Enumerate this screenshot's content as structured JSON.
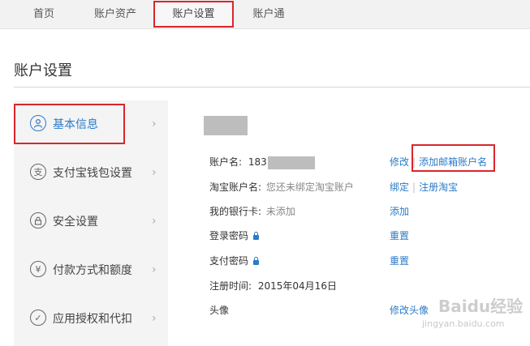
{
  "nav": {
    "tabs": [
      {
        "label": "首页"
      },
      {
        "label": "账户资产"
      },
      {
        "label": "账户设置"
      },
      {
        "label": "账户通"
      }
    ]
  },
  "page": {
    "title": "账户设置"
  },
  "sidebar": {
    "items": [
      {
        "label": "基本信息",
        "icon": "user-icon"
      },
      {
        "label": "支付宝钱包设置",
        "icon": "wallet-icon"
      },
      {
        "label": "安全设置",
        "icon": "lock-icon"
      },
      {
        "label": "付款方式和额度",
        "icon": "yen-icon"
      },
      {
        "label": "应用授权和代扣",
        "icon": "check-icon"
      }
    ]
  },
  "info": {
    "account_label": "账户名:",
    "account_value": "183",
    "taobao_label": "淘宝账户名:",
    "taobao_value": "您还未绑定淘宝账户",
    "bank_label": "我的银行卡:",
    "bank_value": "未添加",
    "login_pwd_label": "登录密码",
    "pay_pwd_label": "支付密码",
    "reg_label": "注册时间:",
    "reg_value": "2015年04月16日",
    "avatar_label": "头像"
  },
  "actions": {
    "modify": "修改",
    "add_email": "添加邮箱账户名",
    "bind": "绑定",
    "register_taobao": "注册淘宝",
    "add": "添加",
    "reset": "重置",
    "modify_avatar": "修改头像"
  },
  "watermark": {
    "text": "Baidu经验",
    "sub": "jingyan.baidu.com"
  }
}
